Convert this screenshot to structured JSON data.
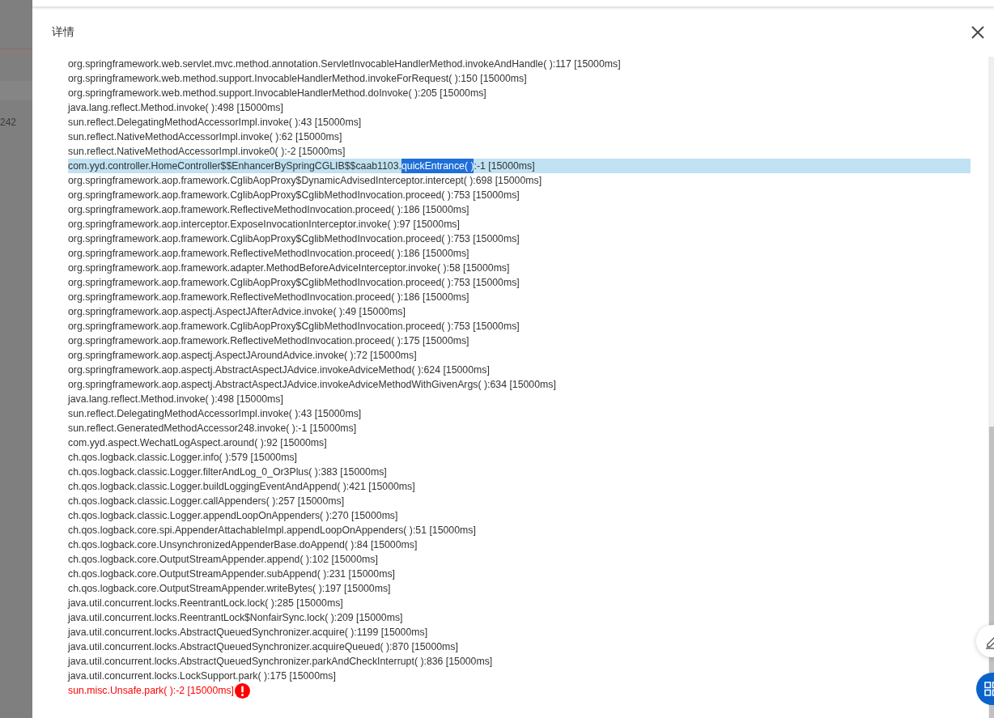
{
  "background": {
    "cell_text": "242"
  },
  "dialog": {
    "title": "详情",
    "lines": [
      {
        "text": "org.springframework.web.servlet.mvc.method.annotation.ServletInvocableHandlerMethod.invokeAndHandle( ):117 [15000ms]",
        "selected": false,
        "kind": "normal"
      },
      {
        "text": "org.springframework.web.method.support.InvocableHandlerMethod.invokeForRequest( ):150 [15000ms]",
        "selected": false,
        "kind": "normal"
      },
      {
        "text": "org.springframework.web.method.support.InvocableHandlerMethod.doInvoke( ):205 [15000ms]",
        "selected": false,
        "kind": "normal"
      },
      {
        "text": "java.lang.reflect.Method.invoke( ):498 [15000ms]",
        "selected": false,
        "kind": "normal"
      },
      {
        "text": "sun.reflect.DelegatingMethodAccessorImpl.invoke( ):43 [15000ms]",
        "selected": false,
        "kind": "normal"
      },
      {
        "text": "sun.reflect.NativeMethodAccessorImpl.invoke( ):62 [15000ms]",
        "selected": false,
        "kind": "normal"
      },
      {
        "text": "sun.reflect.NativeMethodAccessorImpl.invoke0( ):-2 [15000ms]",
        "selected": false,
        "kind": "normal"
      },
      {
        "text": "com.yyd.controller.HomeController$$EnhancerBySpringCGLIB$$caab1103.",
        "highlighted_text": "quickEntrance( )",
        "text_after": ":-1 [15000ms]",
        "selected": true,
        "kind": "normal"
      },
      {
        "text": "org.springframework.aop.framework.CglibAopProxy$DynamicAdvisedInterceptor.intercept( ):698 [15000ms]",
        "selected": false,
        "kind": "normal"
      },
      {
        "text": "org.springframework.aop.framework.CglibAopProxy$CglibMethodInvocation.proceed( ):753 [15000ms]",
        "selected": false,
        "kind": "normal"
      },
      {
        "text": "org.springframework.aop.framework.ReflectiveMethodInvocation.proceed( ):186 [15000ms]",
        "selected": false,
        "kind": "normal"
      },
      {
        "text": "org.springframework.aop.interceptor.ExposeInvocationInterceptor.invoke( ):97 [15000ms]",
        "selected": false,
        "kind": "normal"
      },
      {
        "text": "org.springframework.aop.framework.CglibAopProxy$CglibMethodInvocation.proceed( ):753 [15000ms]",
        "selected": false,
        "kind": "normal"
      },
      {
        "text": "org.springframework.aop.framework.ReflectiveMethodInvocation.proceed( ):186 [15000ms]",
        "selected": false,
        "kind": "normal"
      },
      {
        "text": "org.springframework.aop.framework.adapter.MethodBeforeAdviceInterceptor.invoke( ):58 [15000ms]",
        "selected": false,
        "kind": "normal"
      },
      {
        "text": "org.springframework.aop.framework.CglibAopProxy$CglibMethodInvocation.proceed( ):753 [15000ms]",
        "selected": false,
        "kind": "normal"
      },
      {
        "text": "org.springframework.aop.framework.ReflectiveMethodInvocation.proceed( ):186 [15000ms]",
        "selected": false,
        "kind": "normal"
      },
      {
        "text": "org.springframework.aop.aspectj.AspectJAfterAdvice.invoke( ):49 [15000ms]",
        "selected": false,
        "kind": "normal"
      },
      {
        "text": "org.springframework.aop.framework.CglibAopProxy$CglibMethodInvocation.proceed( ):753 [15000ms]",
        "selected": false,
        "kind": "normal"
      },
      {
        "text": "org.springframework.aop.framework.ReflectiveMethodInvocation.proceed( ):175 [15000ms]",
        "selected": false,
        "kind": "normal"
      },
      {
        "text": "org.springframework.aop.aspectj.AspectJAroundAdvice.invoke( ):72 [15000ms]",
        "selected": false,
        "kind": "normal"
      },
      {
        "text": "org.springframework.aop.aspectj.AbstractAspectJAdvice.invokeAdviceMethod( ):624 [15000ms]",
        "selected": false,
        "kind": "normal"
      },
      {
        "text": "org.springframework.aop.aspectj.AbstractAspectJAdvice.invokeAdviceMethodWithGivenArgs( ):634 [15000ms]",
        "selected": false,
        "kind": "normal"
      },
      {
        "text": "java.lang.reflect.Method.invoke( ):498 [15000ms]",
        "selected": false,
        "kind": "normal"
      },
      {
        "text": "sun.reflect.DelegatingMethodAccessorImpl.invoke( ):43 [15000ms]",
        "selected": false,
        "kind": "normal"
      },
      {
        "text": "sun.reflect.GeneratedMethodAccessor248.invoke( ):-1 [15000ms]",
        "selected": false,
        "kind": "normal"
      },
      {
        "text": "com.yyd.aspect.WechatLogAspect.around( ):92 [15000ms]",
        "selected": false,
        "kind": "normal"
      },
      {
        "text": "ch.qos.logback.classic.Logger.info( ):579 [15000ms]",
        "selected": false,
        "kind": "normal"
      },
      {
        "text": "ch.qos.logback.classic.Logger.filterAndLog_0_Or3Plus( ):383 [15000ms]",
        "selected": false,
        "kind": "normal"
      },
      {
        "text": "ch.qos.logback.classic.Logger.buildLoggingEventAndAppend( ):421 [15000ms]",
        "selected": false,
        "kind": "normal"
      },
      {
        "text": "ch.qos.logback.classic.Logger.callAppenders( ):257 [15000ms]",
        "selected": false,
        "kind": "normal"
      },
      {
        "text": "ch.qos.logback.classic.Logger.appendLoopOnAppenders( ):270 [15000ms]",
        "selected": false,
        "kind": "normal"
      },
      {
        "text": "ch.qos.logback.core.spi.AppenderAttachableImpl.appendLoopOnAppenders( ):51 [15000ms]",
        "selected": false,
        "kind": "normal"
      },
      {
        "text": "ch.qos.logback.core.UnsynchronizedAppenderBase.doAppend( ):84 [15000ms]",
        "selected": false,
        "kind": "normal"
      },
      {
        "text": "ch.qos.logback.core.OutputStreamAppender.append( ):102 [15000ms]",
        "selected": false,
        "kind": "normal"
      },
      {
        "text": "ch.qos.logback.core.OutputStreamAppender.subAppend( ):231 [15000ms]",
        "selected": false,
        "kind": "normal"
      },
      {
        "text": "ch.qos.logback.core.OutputStreamAppender.writeBytes( ):197 [15000ms]",
        "selected": false,
        "kind": "normal"
      },
      {
        "text": "java.util.concurrent.locks.ReentrantLock.lock( ):285 [15000ms]",
        "selected": false,
        "kind": "normal"
      },
      {
        "text": "java.util.concurrent.locks.ReentrantLock$NonfairSync.lock( ):209 [15000ms]",
        "selected": false,
        "kind": "normal"
      },
      {
        "text": "java.util.concurrent.locks.AbstractQueuedSynchronizer.acquire( ):1199 [15000ms]",
        "selected": false,
        "kind": "normal"
      },
      {
        "text": "java.util.concurrent.locks.AbstractQueuedSynchronizer.acquireQueued( ):870 [15000ms]",
        "selected": false,
        "kind": "normal"
      },
      {
        "text": "java.util.concurrent.locks.AbstractQueuedSynchronizer.parkAndCheckInterrupt( ):836 [15000ms]",
        "selected": false,
        "kind": "normal"
      },
      {
        "text": "java.util.concurrent.locks.LockSupport.park( ):175 [15000ms]",
        "selected": false,
        "kind": "normal"
      },
      {
        "text": "sun.misc.Unsafe.park( ):-2 [15000ms]",
        "selected": false,
        "kind": "error"
      }
    ]
  }
}
